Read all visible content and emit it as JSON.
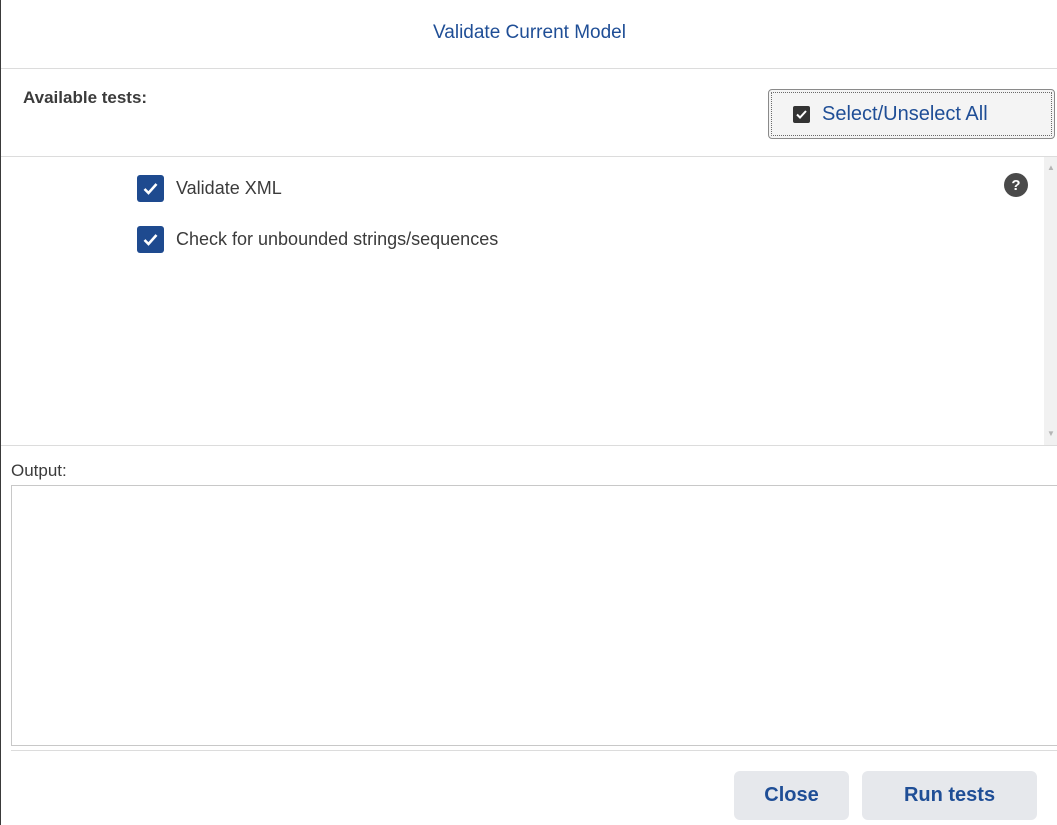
{
  "dialog": {
    "title": "Validate Current Model"
  },
  "tests": {
    "header_label": "Available tests:",
    "select_all_label": "Select/Unselect All",
    "select_all_checked": true,
    "items": [
      {
        "label": "Validate XML",
        "checked": true
      },
      {
        "label": "Check for unbounded strings/sequences",
        "checked": true
      }
    ],
    "help_icon": "question-circle-icon",
    "help_glyph": "?"
  },
  "output": {
    "label": "Output:",
    "value": ""
  },
  "footer": {
    "close_label": "Close",
    "run_label": "Run tests"
  },
  "colors": {
    "accent": "#1f4e96",
    "checkbox": "#1e4a8f",
    "button_bg": "#e6e8ec",
    "text": "#3b3b3b"
  }
}
